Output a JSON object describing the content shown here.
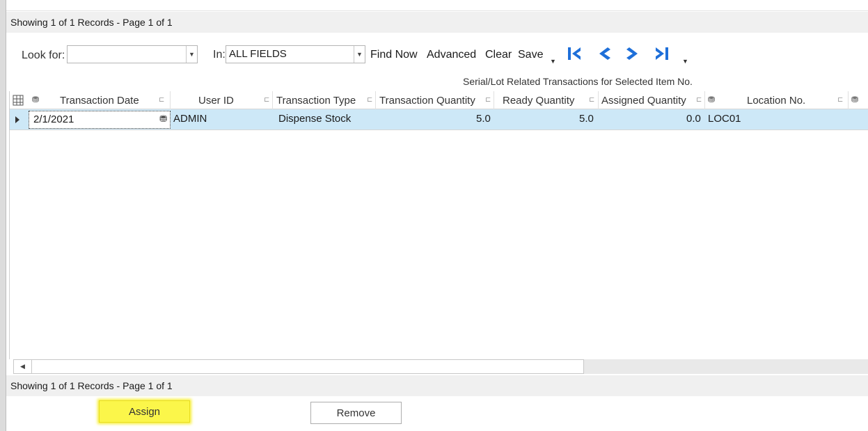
{
  "status": {
    "top": "Showing 1 of 1 Records - Page 1 of 1",
    "bottom": "Showing 1 of 1 Records - Page 1 of 1"
  },
  "toolbar": {
    "look_for_label": "Look for:",
    "look_for_value": "",
    "in_label": "In:",
    "in_value": "ALL FIELDS",
    "find_now": "Find Now",
    "advanced": "Advanced",
    "clear": "Clear",
    "save": "Save",
    "nav_icons": [
      "first-page-icon",
      "previous-page-icon",
      "next-page-icon",
      "last-page-icon"
    ],
    "nav_color": "#1e6fd9"
  },
  "grid": {
    "caption": "Serial/Lot Related Transactions for Selected Item No.",
    "columns": [
      "Transaction Date",
      "User ID",
      "Transaction Type",
      "Transaction Quantity",
      "Ready Quantity",
      "Assigned Quantity",
      "Location No."
    ],
    "rows": [
      {
        "transaction_date": "2/1/2021",
        "user_id": "ADMIN",
        "transaction_type": "Dispense Stock",
        "transaction_quantity": "5.0",
        "ready_quantity": "5.0",
        "assigned_quantity": "0.0",
        "location_no": "LOC01"
      }
    ],
    "selected_row_color": "#cde8f7"
  },
  "buttons": {
    "assign": "Assign",
    "remove": "Remove",
    "highlight_color": "#fbf64a"
  }
}
